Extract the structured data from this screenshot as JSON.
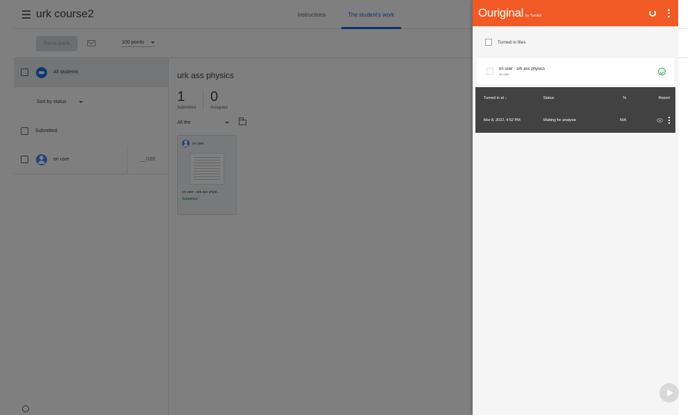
{
  "classroom": {
    "course_title": "urk course2",
    "tabs": [
      "Instructions",
      "The student's work"
    ],
    "toolbar": {
      "send_back": "Send back",
      "points": "100 points"
    },
    "sidebar": {
      "all_students": "All students",
      "sort_by": "Sort by status",
      "group_submitted": "Submitted",
      "student_name": "on user",
      "student_grade": "__/100"
    },
    "assignment": {
      "title": "urk ass physics",
      "submitted_count": "1",
      "submitted_label": "Submitted",
      "assigned_count": "0",
      "assigned_label": "Assigned",
      "filter": "All the",
      "card_user": "on user",
      "card_file": "on user - urk ass physi...",
      "card_status": "Submitted"
    }
  },
  "ouriginal": {
    "brand": "Ouriginal",
    "byline": "by Turnitin",
    "section_title": "Turned in files",
    "file": {
      "name": "on user - urk ass physics",
      "user": "on user"
    },
    "table": {
      "headers": {
        "turned_in": "Turned in at ↓",
        "status": "Status",
        "percent": "%",
        "report": "Report"
      },
      "rows": [
        {
          "turned_in": "Mar 8, 2022, 4:52 PM",
          "status": "Waiting for analysis",
          "percent": "N/A"
        }
      ]
    }
  },
  "colors": {
    "brand_orange": "#f15a24",
    "table_dark": "#424242",
    "check_green": "#34a853",
    "link_blue": "#1967d2"
  },
  "icons": [
    "menu-icon",
    "mail-icon",
    "caret-down-icon",
    "folder-icon",
    "help-icon",
    "refresh-icon",
    "more-vert-icon",
    "check-circle-icon",
    "eye-icon",
    "send-icon"
  ]
}
